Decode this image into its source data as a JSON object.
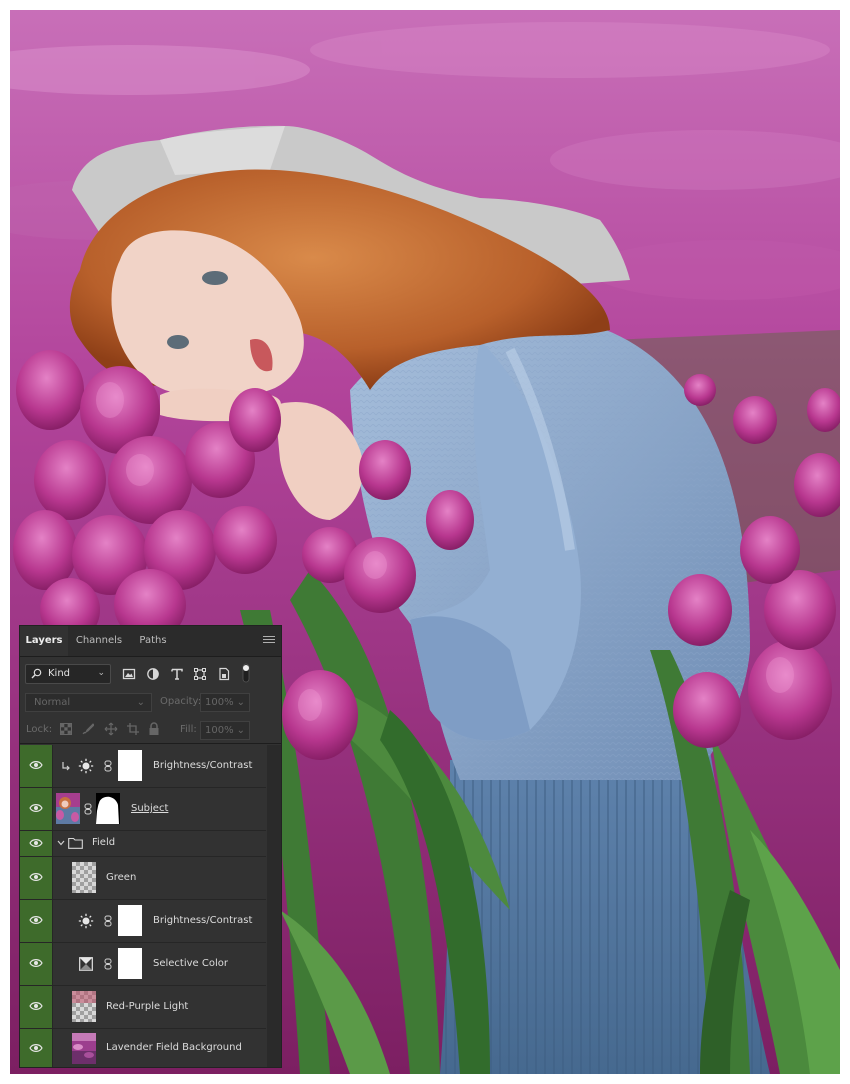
{
  "panel": {
    "tabs": [
      "Layers",
      "Channels",
      "Paths"
    ],
    "filter_kind": "Kind",
    "blend_mode": "Normal",
    "opacity_label": "Opacity:",
    "opacity_value": "100%",
    "lock_label": "Lock:",
    "fill_label": "Fill:",
    "fill_value": "100%"
  },
  "layers": [
    {
      "name": "Brightness/Contrast",
      "type": "adjustment-brightness",
      "clipped": true,
      "visible": true
    },
    {
      "name": "Subject",
      "type": "image-with-mask",
      "visible": true
    },
    {
      "name": "Field",
      "type": "group",
      "expanded": true,
      "visible": true
    },
    {
      "name": "Green",
      "type": "empty-layer",
      "visible": true
    },
    {
      "name": "Brightness/Contrast",
      "type": "adjustment-brightness",
      "visible": true
    },
    {
      "name": "Selective Color",
      "type": "adjustment-selective-color",
      "visible": true
    },
    {
      "name": "Red-Purple Light",
      "type": "empty-layer",
      "visible": true
    },
    {
      "name": "Lavender Field Background",
      "type": "image",
      "visible": true
    }
  ],
  "colors": {
    "panel_bg": "#323232",
    "eye_cell_bg": "#3e6b2b",
    "photo_magenta": "#b43f9a"
  }
}
